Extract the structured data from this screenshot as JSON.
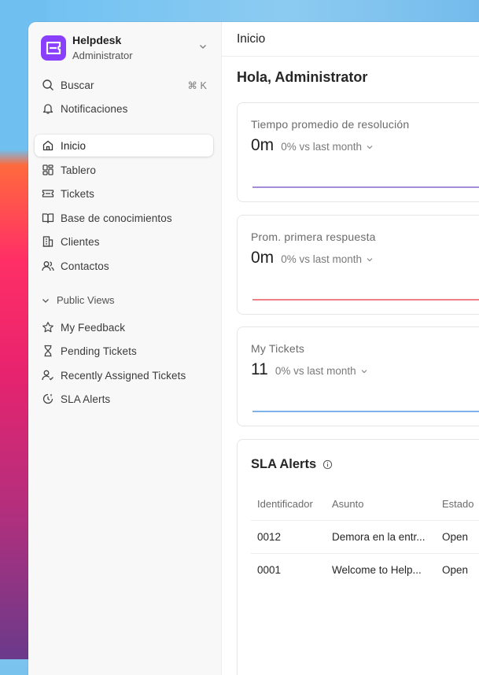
{
  "sidebar": {
    "brand": {
      "name": "Helpdesk",
      "role": "Administrator"
    },
    "search": {
      "label": "Buscar",
      "shortcut": "⌘ K"
    },
    "notifications": {
      "label": "Notificaciones"
    },
    "items": [
      {
        "label": "Inicio",
        "icon": "home-icon",
        "active": true
      },
      {
        "label": "Tablero",
        "icon": "dashboard-icon"
      },
      {
        "label": "Tickets",
        "icon": "ticket-icon"
      },
      {
        "label": "Base de conocimientos",
        "icon": "book-icon"
      },
      {
        "label": "Clientes",
        "icon": "building-icon"
      },
      {
        "label": "Contactos",
        "icon": "users-icon"
      }
    ],
    "public_views": {
      "title": "Public Views",
      "items": [
        {
          "label": "My Feedback",
          "icon": "star-icon"
        },
        {
          "label": "Pending Tickets",
          "icon": "hourglass-icon"
        },
        {
          "label": "Recently Assigned Tickets",
          "icon": "user-check-icon"
        },
        {
          "label": "SLA Alerts",
          "icon": "clock-alert-icon"
        }
      ]
    }
  },
  "main": {
    "breadcrumb": "Inicio",
    "greeting": "Hola, Administrator",
    "cards": [
      {
        "title": "Tiempo promedio de resolución",
        "value": "0m",
        "delta": "0% vs last month",
        "line_color": "#a78bdb"
      },
      {
        "title": "Prom. primera respuesta",
        "value": "0m",
        "delta": "0% vs last month",
        "line_color": "#f07f86"
      },
      {
        "title": "My Tickets",
        "value": "11",
        "delta": "0% vs last month",
        "line_color": "#7fb2ea"
      }
    ],
    "sla": {
      "title": "SLA Alerts",
      "columns": [
        "Identificador",
        "Asunto",
        "Estado"
      ],
      "rows": [
        {
          "id": "0012",
          "subject": "Demora en la entr...",
          "status": "Open"
        },
        {
          "id": "0001",
          "subject": "Welcome to Help...",
          "status": "Open"
        }
      ]
    }
  },
  "colors": {
    "brand": "#8a3ffc",
    "sidebar_bg": "#f8f8f8"
  }
}
